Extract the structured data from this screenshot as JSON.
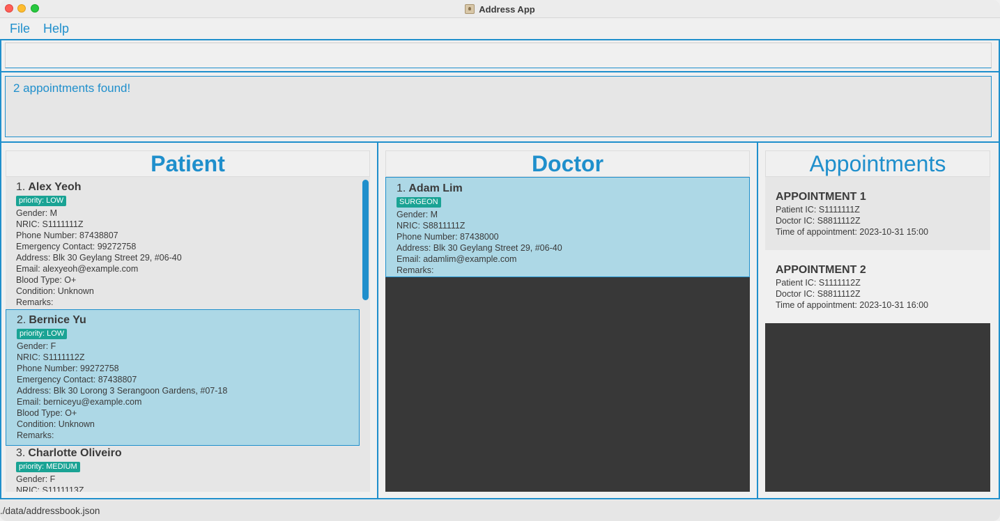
{
  "window": {
    "title": "Address App"
  },
  "menu": {
    "file": "File",
    "help": "Help"
  },
  "command": {
    "value": "",
    "placeholder": ""
  },
  "result": {
    "message": "2 appointments found!"
  },
  "panels": {
    "patient": "Patient",
    "doctor": "Doctor",
    "appointments": "Appointments"
  },
  "patients": [
    {
      "index": "1.",
      "name": "Alex Yeoh",
      "tag": "priority: LOW",
      "gender": "Gender: M",
      "nric": "NRIC: S1111111Z",
      "phone": "Phone Number: 87438807",
      "emergency": "Emergency Contact: 99272758",
      "address": "Address: Blk 30 Geylang Street 29, #06-40",
      "email": "Email: alexyeoh@example.com",
      "blood": "Blood Type: O+",
      "condition": "Condition: Unknown",
      "remarks": "Remarks:"
    },
    {
      "index": "2.",
      "name": "Bernice Yu",
      "tag": "priority: LOW",
      "gender": "Gender: F",
      "nric": "NRIC: S1111112Z",
      "phone": "Phone Number: 99272758",
      "emergency": "Emergency Contact: 87438807",
      "address": "Address: Blk 30 Lorong 3 Serangoon Gardens, #07-18",
      "email": "Email: berniceyu@example.com",
      "blood": "Blood Type: O+",
      "condition": "Condition: Unknown",
      "remarks": "Remarks:"
    },
    {
      "index": "3.",
      "name": "Charlotte Oliveiro",
      "tag": "priority: MEDIUM",
      "gender": "Gender: F",
      "nric": "NRIC: S1111113Z"
    }
  ],
  "doctors": [
    {
      "index": "1.",
      "name": "Adam Lim",
      "tag": "SURGEON",
      "gender": "Gender: M",
      "nric": "NRIC: S8811111Z",
      "phone": "Phone Number: 87438000",
      "address": "Address: Blk 30 Geylang Street 29, #06-40",
      "email": "Email: adamlim@example.com",
      "remarks": "Remarks:"
    }
  ],
  "appointments": [
    {
      "title": "APPOINTMENT 1",
      "patient": "Patient IC: S1111111Z",
      "doctor": "Doctor IC: S8811112Z",
      "time": "Time of appointment: 2023-10-31 15:00"
    },
    {
      "title": "APPOINTMENT 2",
      "patient": "Patient IC: S1111112Z",
      "doctor": "Doctor IC: S8811112Z",
      "time": "Time of appointment: 2023-10-31 16:00"
    }
  ],
  "status": {
    "path": "./data/addressbook.json"
  },
  "colors": {
    "accent": "#1f8fcc",
    "selected": "#add8e6",
    "tag": "#1aa394",
    "dark": "#383838"
  }
}
